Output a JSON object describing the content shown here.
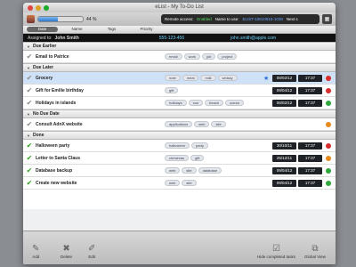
{
  "window": {
    "title": "eList - My To-Do List"
  },
  "toolbar": {
    "progress_percent": 44,
    "progress_label": "44 %",
    "lcd": {
      "remote_label": "Remote access:",
      "remote_value": "Enabled",
      "name_label": "Name to use:",
      "name_value": "ELIST-10610915-1038",
      "next_label": "Next s"
    }
  },
  "columns": [
    "Date",
    "Name",
    "Tags",
    "Priority"
  ],
  "assigned": {
    "label": "Assigned to:",
    "name": "John Smith",
    "phone": "555-123-456",
    "email": "john.smith@apple.com"
  },
  "groups": [
    {
      "title": "Due Earlier",
      "rows": [
        {
          "title": "Email to Patrice",
          "tags": [
            "email",
            "work",
            "job",
            "project"
          ],
          "date": "",
          "time": "",
          "star": false,
          "done": false,
          "selected": false,
          "dot": ""
        }
      ]
    },
    {
      "title": "Due Later",
      "rows": [
        {
          "title": "Grocery",
          "tags": [
            "note",
            "meal",
            "milk",
            "whisky"
          ],
          "date": "08/02/12",
          "time": "17:37",
          "star": true,
          "done": false,
          "selected": true,
          "dot": "#d92c2c"
        },
        {
          "title": "Gift for Emilie birthday",
          "tags": [
            "gift"
          ],
          "date": "09/04/12",
          "time": "17:37",
          "star": false,
          "done": false,
          "selected": false,
          "dot": "#d92c2c"
        },
        {
          "title": "Holidays in islands",
          "tags": [
            "holidays",
            "sun",
            "beach",
            "ocean"
          ],
          "date": "08/02/12",
          "time": "17:37",
          "star": false,
          "done": false,
          "selected": false,
          "dot": "#2fa73a"
        }
      ]
    },
    {
      "title": "No Due Date",
      "rows": [
        {
          "title": "Consult AdnX website",
          "tags": [
            "applications",
            "web",
            "site"
          ],
          "date": "",
          "time": "",
          "star": false,
          "done": false,
          "selected": false,
          "dot": "#e68a1c"
        }
      ]
    },
    {
      "title": "Done",
      "rows": [
        {
          "title": "Halloween party",
          "tags": [
            "halloween",
            "party"
          ],
          "date": "30/10/11",
          "time": "17:37",
          "star": false,
          "done": true,
          "selected": false,
          "dot": "#d92c2c"
        },
        {
          "title": "Letter to Santa Claus",
          "tags": [
            "christmas",
            "gift"
          ],
          "date": "25/12/11",
          "time": "17:37",
          "star": false,
          "done": true,
          "selected": false,
          "dot": "#e68a1c"
        },
        {
          "title": "Database backup",
          "tags": [
            "web",
            "site",
            "database"
          ],
          "date": "09/04/12",
          "time": "17:37",
          "star": false,
          "done": true,
          "selected": false,
          "dot": "#2fa73a"
        },
        {
          "title": "Create new website",
          "tags": [
            "web",
            "site"
          ],
          "date": "09/04/12",
          "time": "17:37",
          "star": false,
          "done": true,
          "selected": false,
          "dot": "#2fa73a"
        }
      ]
    }
  ],
  "bottom": {
    "add": "Add",
    "delete": "Delete",
    "edit": "Edit",
    "hide_completed": "Hide completed tasks",
    "global_view": "Global View"
  }
}
